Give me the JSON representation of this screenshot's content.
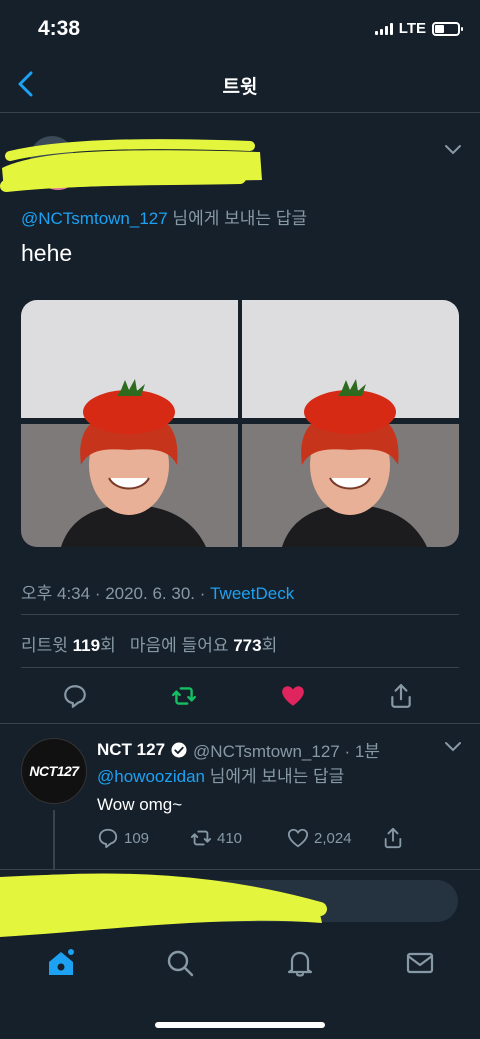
{
  "status_bar": {
    "time": "4:38",
    "network": "LTE"
  },
  "header": {
    "title": "트윗"
  },
  "tweet": {
    "reply_to_handle": "@NCTsmtown_127",
    "reply_to_suffix": " 님에게 보내는 답글",
    "text": "hehe",
    "time": "오후 4:34 · 2020. 6. 30. · ",
    "source": "TweetDeck",
    "retweets_label": "리트윗 ",
    "retweets": "119",
    "retweets_unit": "회",
    "likes_label": "마음에 들어요 ",
    "likes": "773",
    "likes_unit": "회"
  },
  "reply": {
    "avatar_text": "NCT127",
    "name": "NCT 127",
    "handle_time": "@NCTsmtown_127 · 1분",
    "reply_to_handle": "@howoozidan",
    "reply_to_suffix": " 님에게 보내는 답글",
    "text": "Wow omg~",
    "replies": "109",
    "retweets": "410",
    "likes": "2,024"
  },
  "colors": {
    "background": "#15202b",
    "accent": "#1da1f2",
    "retweet": "#17bf63",
    "like": "#e0245e",
    "scribble": "#e4f53d"
  },
  "icons": [
    "back-arrow-icon",
    "chevron-down-icon",
    "reply-icon",
    "retweet-icon",
    "heart-icon",
    "share-icon",
    "verified-icon",
    "home-icon",
    "search-icon",
    "bell-icon",
    "mail-icon"
  ]
}
